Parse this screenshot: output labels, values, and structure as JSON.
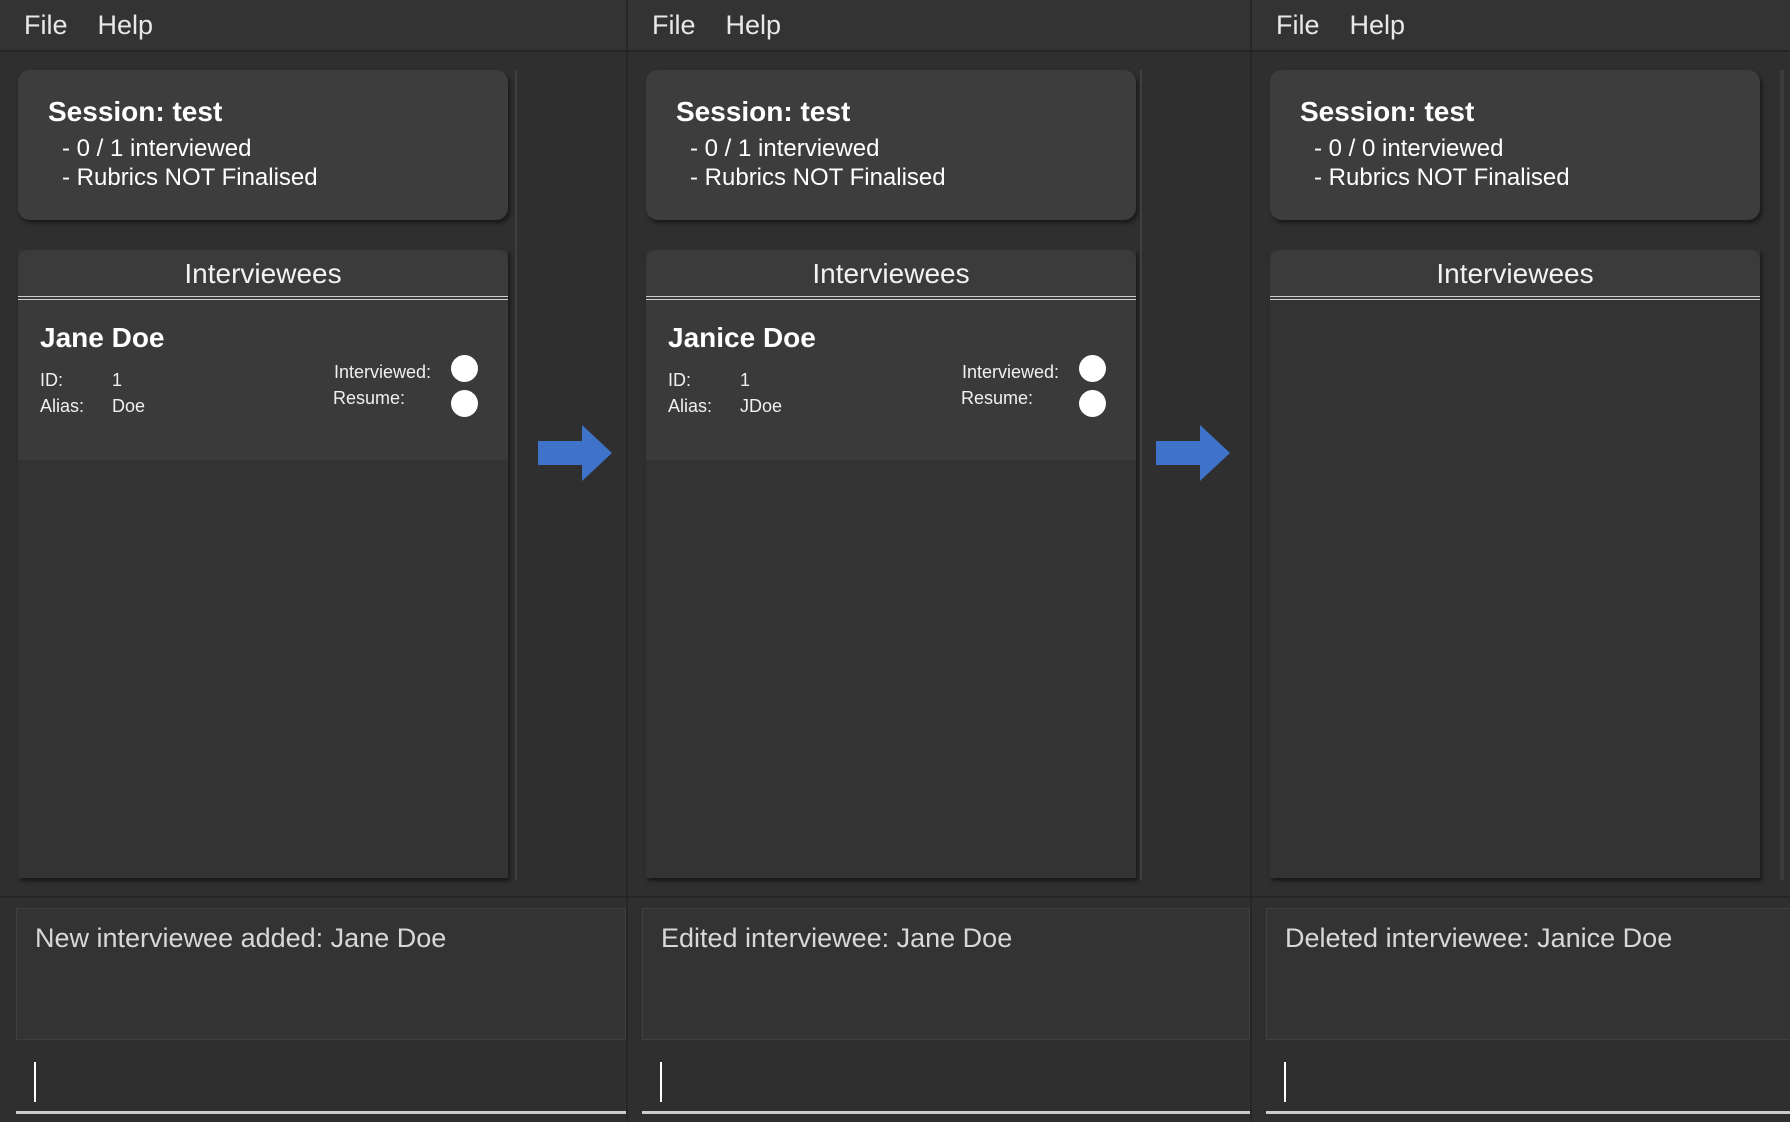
{
  "colors": {
    "background": "#2b2b2b",
    "card": "#3d3d3d",
    "arrow": "#3f72c9"
  },
  "panels": [
    {
      "menu": [
        "File",
        "Help"
      ],
      "session": {
        "title": "Session: test",
        "interviewed": "- 0 / 1 interviewed",
        "rubrics": "- Rubrics NOT Finalised"
      },
      "list_header": "Interviewees",
      "interviewee": {
        "name": "Jane Doe",
        "id_label": "ID:",
        "id_value": "1",
        "alias_label": "Alias:",
        "alias_value": "Doe",
        "interviewed_label": "Interviewed:",
        "resume_label": "Resume:"
      },
      "result": "New interviewee added: Jane Doe",
      "command": ""
    },
    {
      "menu": [
        "File",
        "Help"
      ],
      "session": {
        "title": "Session: test",
        "interviewed": "- 0 / 1 interviewed",
        "rubrics": "- Rubrics NOT Finalised"
      },
      "list_header": "Interviewees",
      "interviewee": {
        "name": "Janice Doe",
        "id_label": "ID:",
        "id_value": "1",
        "alias_label": "Alias:",
        "alias_value": "JDoe",
        "interviewed_label": "Interviewed:",
        "resume_label": "Resume:"
      },
      "result": "Edited interviewee: Jane Doe",
      "command": ""
    },
    {
      "menu": [
        "File",
        "Help"
      ],
      "session": {
        "title": "Session: test",
        "interviewed": "- 0 / 0 interviewed",
        "rubrics": "- Rubrics NOT Finalised"
      },
      "list_header": "Interviewees",
      "result": "Deleted interviewee: Janice Doe",
      "command": ""
    }
  ]
}
